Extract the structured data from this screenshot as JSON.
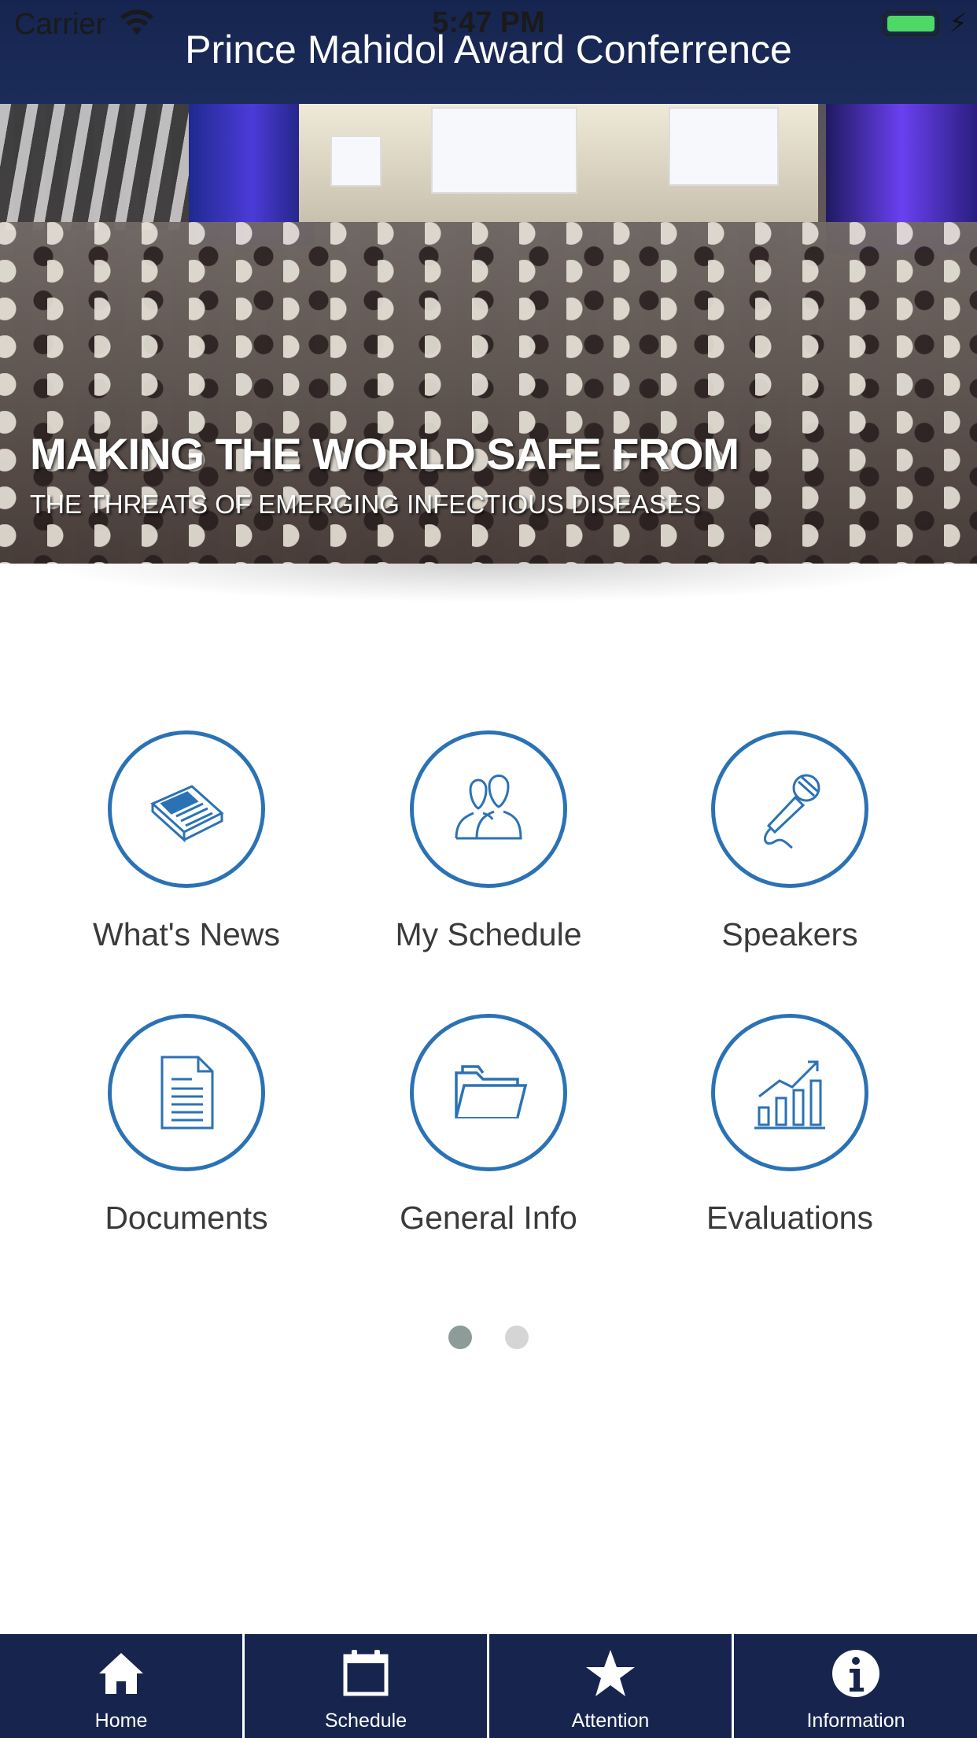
{
  "status_bar": {
    "carrier": "Carrier",
    "time": "5:47 PM"
  },
  "header": {
    "title": "Prince Mahidol Award Conferrence"
  },
  "hero": {
    "title": "MAKING THE WORLD SAFE FROM",
    "subtitle": "THE THREATS OF EMERGING INFECTIOUS DISEASES"
  },
  "menu": {
    "items": [
      {
        "label": "What's News",
        "icon": "newspaper-icon"
      },
      {
        "label": "My Schedule",
        "icon": "people-icon"
      },
      {
        "label": "Speakers",
        "icon": "microphone-icon"
      },
      {
        "label": "Documents",
        "icon": "document-icon"
      },
      {
        "label": "General Info",
        "icon": "folder-icon"
      },
      {
        "label": "Evaluations",
        "icon": "chart-icon"
      }
    ]
  },
  "pager": {
    "current_page": 1,
    "total_pages": 2
  },
  "tabbar": {
    "tabs": [
      {
        "label": "Home",
        "icon": "home-icon"
      },
      {
        "label": "Schedule",
        "icon": "calendar-icon"
      },
      {
        "label": "Attention",
        "icon": "star-icon"
      },
      {
        "label": "Information",
        "icon": "info-icon"
      }
    ]
  },
  "colors": {
    "header_bg": "#1c2c5a",
    "accent_blue": "#2b72b5",
    "battery_green": "#4cd964",
    "dot_active": "#8d9c98",
    "dot_inactive": "#d5d5d5"
  }
}
